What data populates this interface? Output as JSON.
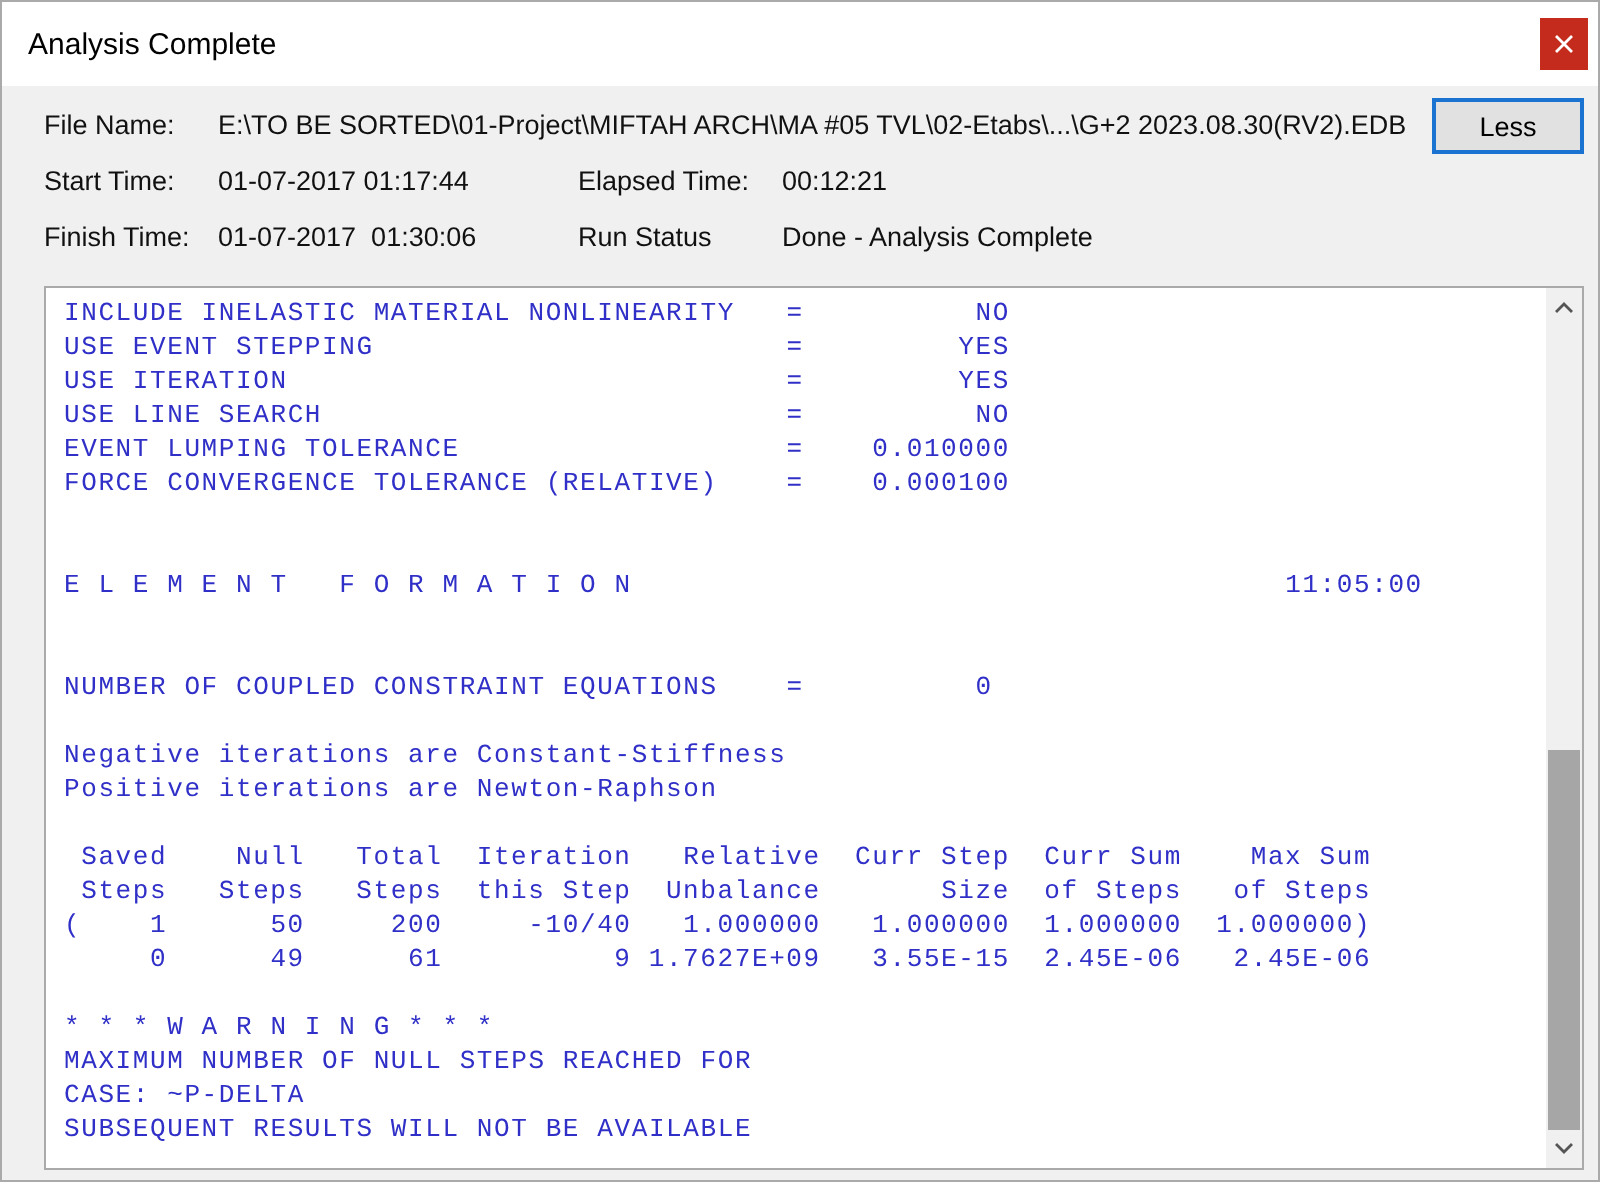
{
  "window": {
    "title": "Analysis Complete"
  },
  "info_rows": [
    [
      {
        "label": "File Name:",
        "value": "E:\\TO BE SORTED\\01-Project\\MIFTAH ARCH\\MA #05 TVL\\02-Etabs\\...\\G+2 2023.08.30(RV2).EDB"
      }
    ],
    [
      {
        "label": "Start Time:",
        "value": "01-07-2017 01:17:44"
      },
      {
        "label": "Elapsed Time:",
        "value": "00:12:21"
      }
    ],
    [
      {
        "label": "Finish Time:",
        "value": "01-07-2017  01:30:06"
      },
      {
        "label": "Run Status",
        "value": "Done - Analysis Complete"
      }
    ]
  ],
  "less_button": "Less",
  "log": {
    "settings": [
      {
        "label": "INCLUDE INELASTIC MATERIAL NONLINEARITY",
        "equals": "=",
        "value": "NO"
      },
      {
        "label": "USE EVENT STEPPING",
        "equals": "=",
        "value": "YES"
      },
      {
        "label": "USE ITERATION",
        "equals": "=",
        "value": "YES"
      },
      {
        "label": "USE LINE SEARCH",
        "equals": "=",
        "value": "NO"
      },
      {
        "label": "EVENT LUMPING TOLERANCE",
        "equals": "=",
        "value": "0.010000"
      },
      {
        "label": "FORCE CONVERGENCE TOLERANCE (RELATIVE)",
        "equals": "=",
        "value": "0.000100"
      }
    ],
    "section": {
      "title": "E L E M E N T   F O R M A T I O N",
      "time": "11:05:00"
    },
    "coupled": {
      "label": "NUMBER OF COUPLED CONSTRAINT EQUATIONS",
      "equals": "=",
      "value": "0"
    },
    "notes": [
      "Negative iterations are Constant-Stiffness",
      "Positive iterations are Newton-Raphson"
    ],
    "table": {
      "header_rows": [
        [
          "Saved",
          "Null",
          "Total",
          "Iteration",
          "Relative",
          "Curr Step",
          "Curr Sum",
          "Max Sum"
        ],
        [
          "Steps",
          "Steps",
          "Steps",
          "this Step",
          "Unbalance",
          "Size",
          "of Steps",
          "of Steps"
        ]
      ],
      "rows": [
        {
          "prefix": "(",
          "cells": [
            "1",
            "50",
            "200",
            "-10/40",
            "1.000000",
            "1.000000",
            "1.000000",
            "1.000000)"
          ]
        },
        {
          "cells": [
            "0",
            "49",
            "61",
            "9",
            "1.7627E+09",
            "3.55E-15",
            "2.45E-06",
            "2.45E-06"
          ]
        }
      ]
    },
    "warning": [
      "* * * W A R N I N G * * *",
      "MAXIMUM NUMBER OF NULL STEPS REACHED FOR",
      "CASE: ~P-DELTA",
      "SUBSEQUENT RESULTS WILL NOT BE AVAILABLE"
    ]
  }
}
